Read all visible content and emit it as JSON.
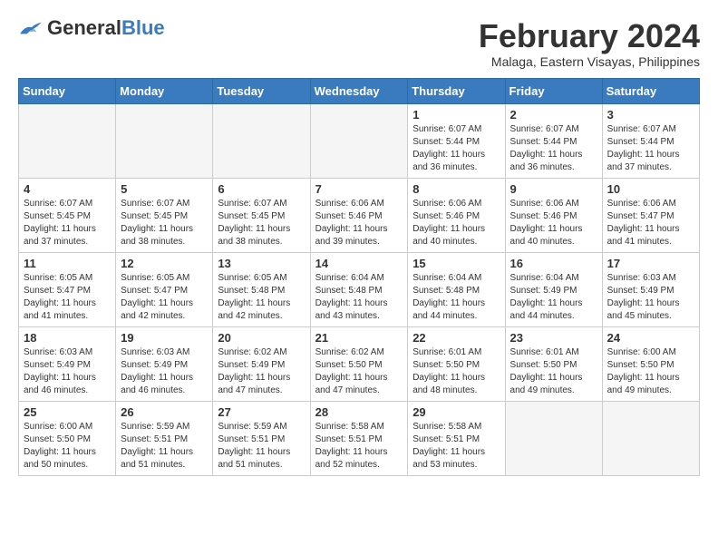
{
  "header": {
    "logo_general": "General",
    "logo_blue": "Blue",
    "month_year": "February 2024",
    "location": "Malaga, Eastern Visayas, Philippines"
  },
  "calendar": {
    "headers": [
      "Sunday",
      "Monday",
      "Tuesday",
      "Wednesday",
      "Thursday",
      "Friday",
      "Saturday"
    ],
    "weeks": [
      [
        {
          "day": "",
          "info": "",
          "empty": true
        },
        {
          "day": "",
          "info": "",
          "empty": true
        },
        {
          "day": "",
          "info": "",
          "empty": true
        },
        {
          "day": "",
          "info": "",
          "empty": true
        },
        {
          "day": "1",
          "info": "Sunrise: 6:07 AM\nSunset: 5:44 PM\nDaylight: 11 hours\nand 36 minutes."
        },
        {
          "day": "2",
          "info": "Sunrise: 6:07 AM\nSunset: 5:44 PM\nDaylight: 11 hours\nand 36 minutes."
        },
        {
          "day": "3",
          "info": "Sunrise: 6:07 AM\nSunset: 5:44 PM\nDaylight: 11 hours\nand 37 minutes."
        }
      ],
      [
        {
          "day": "4",
          "info": "Sunrise: 6:07 AM\nSunset: 5:45 PM\nDaylight: 11 hours\nand 37 minutes."
        },
        {
          "day": "5",
          "info": "Sunrise: 6:07 AM\nSunset: 5:45 PM\nDaylight: 11 hours\nand 38 minutes."
        },
        {
          "day": "6",
          "info": "Sunrise: 6:07 AM\nSunset: 5:45 PM\nDaylight: 11 hours\nand 38 minutes."
        },
        {
          "day": "7",
          "info": "Sunrise: 6:06 AM\nSunset: 5:46 PM\nDaylight: 11 hours\nand 39 minutes."
        },
        {
          "day": "8",
          "info": "Sunrise: 6:06 AM\nSunset: 5:46 PM\nDaylight: 11 hours\nand 40 minutes."
        },
        {
          "day": "9",
          "info": "Sunrise: 6:06 AM\nSunset: 5:46 PM\nDaylight: 11 hours\nand 40 minutes."
        },
        {
          "day": "10",
          "info": "Sunrise: 6:06 AM\nSunset: 5:47 PM\nDaylight: 11 hours\nand 41 minutes."
        }
      ],
      [
        {
          "day": "11",
          "info": "Sunrise: 6:05 AM\nSunset: 5:47 PM\nDaylight: 11 hours\nand 41 minutes."
        },
        {
          "day": "12",
          "info": "Sunrise: 6:05 AM\nSunset: 5:47 PM\nDaylight: 11 hours\nand 42 minutes."
        },
        {
          "day": "13",
          "info": "Sunrise: 6:05 AM\nSunset: 5:48 PM\nDaylight: 11 hours\nand 42 minutes."
        },
        {
          "day": "14",
          "info": "Sunrise: 6:04 AM\nSunset: 5:48 PM\nDaylight: 11 hours\nand 43 minutes."
        },
        {
          "day": "15",
          "info": "Sunrise: 6:04 AM\nSunset: 5:48 PM\nDaylight: 11 hours\nand 44 minutes."
        },
        {
          "day": "16",
          "info": "Sunrise: 6:04 AM\nSunset: 5:49 PM\nDaylight: 11 hours\nand 44 minutes."
        },
        {
          "day": "17",
          "info": "Sunrise: 6:03 AM\nSunset: 5:49 PM\nDaylight: 11 hours\nand 45 minutes."
        }
      ],
      [
        {
          "day": "18",
          "info": "Sunrise: 6:03 AM\nSunset: 5:49 PM\nDaylight: 11 hours\nand 46 minutes."
        },
        {
          "day": "19",
          "info": "Sunrise: 6:03 AM\nSunset: 5:49 PM\nDaylight: 11 hours\nand 46 minutes."
        },
        {
          "day": "20",
          "info": "Sunrise: 6:02 AM\nSunset: 5:49 PM\nDaylight: 11 hours\nand 47 minutes."
        },
        {
          "day": "21",
          "info": "Sunrise: 6:02 AM\nSunset: 5:50 PM\nDaylight: 11 hours\nand 47 minutes."
        },
        {
          "day": "22",
          "info": "Sunrise: 6:01 AM\nSunset: 5:50 PM\nDaylight: 11 hours\nand 48 minutes."
        },
        {
          "day": "23",
          "info": "Sunrise: 6:01 AM\nSunset: 5:50 PM\nDaylight: 11 hours\nand 49 minutes."
        },
        {
          "day": "24",
          "info": "Sunrise: 6:00 AM\nSunset: 5:50 PM\nDaylight: 11 hours\nand 49 minutes."
        }
      ],
      [
        {
          "day": "25",
          "info": "Sunrise: 6:00 AM\nSunset: 5:50 PM\nDaylight: 11 hours\nand 50 minutes."
        },
        {
          "day": "26",
          "info": "Sunrise: 5:59 AM\nSunset: 5:51 PM\nDaylight: 11 hours\nand 51 minutes."
        },
        {
          "day": "27",
          "info": "Sunrise: 5:59 AM\nSunset: 5:51 PM\nDaylight: 11 hours\nand 51 minutes."
        },
        {
          "day": "28",
          "info": "Sunrise: 5:58 AM\nSunset: 5:51 PM\nDaylight: 11 hours\nand 52 minutes."
        },
        {
          "day": "29",
          "info": "Sunrise: 5:58 AM\nSunset: 5:51 PM\nDaylight: 11 hours\nand 53 minutes."
        },
        {
          "day": "",
          "info": "",
          "empty": true
        },
        {
          "day": "",
          "info": "",
          "empty": true
        }
      ]
    ]
  }
}
